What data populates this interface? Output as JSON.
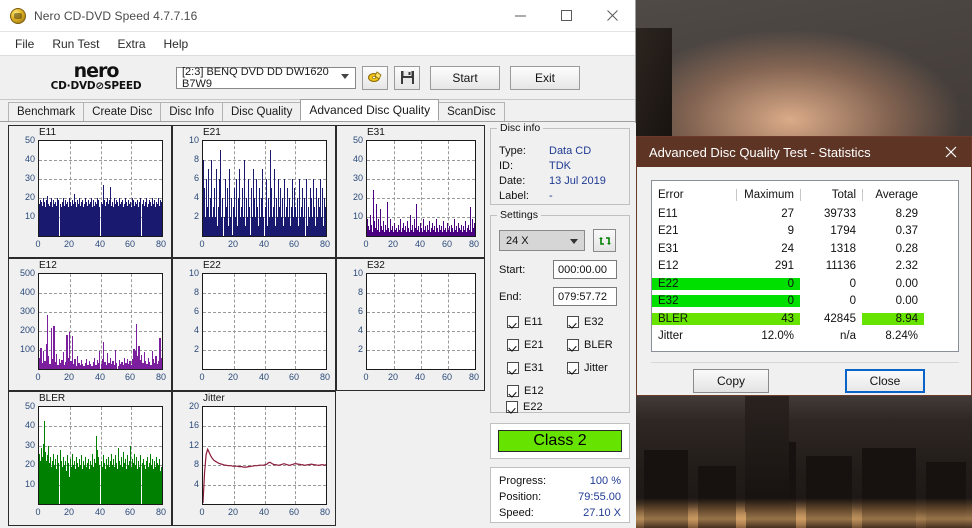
{
  "window": {
    "title": "Nero CD-DVD Speed 4.7.7.16",
    "icon": "nero-disc-icon",
    "minimize": "minimize-icon",
    "maximize": "maximize-icon",
    "close": "close-icon"
  },
  "menubar": {
    "items": [
      "File",
      "Run Test",
      "Extra",
      "Help"
    ]
  },
  "brand": {
    "line1": "nero",
    "line2": "CD·DVD⊘SPEED"
  },
  "toolbar": {
    "drive": "[2:3]   BENQ DVD DD DW1620 B7W9",
    "eject_icon": "eject-disc-icon",
    "save_icon": "floppy-save-icon",
    "start_label": "Start",
    "exit_label": "Exit"
  },
  "tabs": [
    {
      "label": "Benchmark",
      "active": false
    },
    {
      "label": "Create Disc",
      "active": false
    },
    {
      "label": "Disc Info",
      "active": false
    },
    {
      "label": "Disc Quality",
      "active": false
    },
    {
      "label": "Advanced Disc Quality",
      "active": true
    },
    {
      "label": "ScanDisc",
      "active": false
    }
  ],
  "disc_info": {
    "legend": "Disc info",
    "rows": [
      {
        "key": "Type:",
        "value": "Data CD"
      },
      {
        "key": "ID:",
        "value": "TDK"
      },
      {
        "key": "Date:",
        "value": "13 Jul 2019"
      },
      {
        "key": "Label:",
        "value": "-"
      }
    ]
  },
  "settings": {
    "legend": "Settings",
    "speed": "24 X",
    "refresh_icon": "refresh-speed-icon",
    "start_label": "Start:",
    "start_value": "000:00.00",
    "end_label": "End:",
    "end_value": "079:57.72",
    "checkboxes_left": [
      "E11",
      "E21",
      "E31",
      "E12",
      "E22"
    ],
    "checkboxes_right": [
      "E32",
      "BLER",
      "Jitter"
    ]
  },
  "class_badge": {
    "label": "Class 2",
    "color": "#66e400"
  },
  "progress": {
    "rows": [
      {
        "key": "Progress:",
        "value": "100 %"
      },
      {
        "key": "Position:",
        "value": "79:55.00"
      },
      {
        "key": "Speed:",
        "value": "27.10 X"
      }
    ]
  },
  "statistics": {
    "title": "Advanced Disc Quality Test - Statistics",
    "close_icon": "close-icon",
    "columns": [
      "Error",
      "Maximum",
      "Total",
      "Average"
    ],
    "rows": [
      {
        "error": "E11",
        "maximum": "27",
        "total": "39733",
        "average": "8.29",
        "highlight": "none"
      },
      {
        "error": "E21",
        "maximum": "9",
        "total": "1794",
        "average": "0.37",
        "highlight": "none"
      },
      {
        "error": "E31",
        "maximum": "24",
        "total": "1318",
        "average": "0.28",
        "highlight": "none"
      },
      {
        "error": "E12",
        "maximum": "291",
        "total": "11136",
        "average": "2.32",
        "highlight": "none"
      },
      {
        "error": "E22",
        "maximum": "0",
        "total": "0",
        "average": "0.00",
        "highlight": "green-left"
      },
      {
        "error": "E32",
        "maximum": "0",
        "total": "0",
        "average": "0.00",
        "highlight": "green-left"
      },
      {
        "error": "BLER",
        "maximum": "43",
        "total": "42845",
        "average": "8.94",
        "highlight": "lime-left-avg"
      },
      {
        "error": "Jitter",
        "maximum": "12.0%",
        "total": "n/a",
        "average": "8.24%",
        "highlight": "none"
      }
    ],
    "copy_label": "Copy",
    "close_label": "Close",
    "colors": {
      "title_bar": "#5e3524",
      "green": "#00e000",
      "lime": "#66e400"
    }
  },
  "chart_data": [
    {
      "type": "bar",
      "name": "E11",
      "title": "E11",
      "color": "#191970",
      "xlabel": "",
      "ylabel": "",
      "xlim": [
        0,
        80
      ],
      "ylim": [
        0,
        50
      ],
      "grid": true,
      "xticks": [
        0,
        20,
        40,
        60,
        80
      ],
      "yticks": [
        10,
        20,
        30,
        40,
        50
      ],
      "values": [
        17,
        19,
        18,
        16,
        20,
        18,
        15,
        19,
        21,
        17,
        16,
        18,
        20,
        15,
        19,
        17,
        18,
        16,
        20,
        19,
        17,
        15,
        18,
        20,
        16,
        19,
        17,
        18,
        15,
        20,
        18,
        16,
        19,
        17,
        22,
        18,
        15,
        19,
        17,
        20,
        16,
        18,
        19,
        15,
        17,
        20,
        18,
        16,
        19,
        17,
        18,
        20,
        15,
        19,
        16,
        18,
        17,
        20,
        19,
        15,
        18,
        17,
        27,
        19,
        16,
        18,
        20,
        17,
        19,
        26,
        16,
        18,
        15,
        20,
        17,
        19,
        18,
        16,
        20,
        17,
        18,
        19,
        15,
        17,
        20,
        18,
        16,
        19,
        17,
        18,
        15,
        20,
        19,
        16,
        18,
        17,
        19,
        15,
        18,
        20,
        17,
        19,
        16,
        18,
        20,
        15,
        17,
        19,
        18,
        16,
        20,
        17,
        19,
        15,
        18,
        17,
        20,
        16,
        19,
        18
      ]
    },
    {
      "type": "bar",
      "name": "E21",
      "title": "E21",
      "color": "#191970",
      "xlabel": "",
      "ylabel": "",
      "xlim": [
        0,
        80
      ],
      "ylim": [
        0,
        10
      ],
      "grid": true,
      "xticks": [
        0,
        20,
        40,
        60,
        80
      ],
      "yticks": [
        2,
        4,
        6,
        8,
        10
      ],
      "values": [
        8,
        5,
        2,
        6,
        3,
        7,
        2,
        4,
        8,
        2,
        3,
        5,
        2,
        7,
        1,
        3,
        6,
        9,
        2,
        4,
        2,
        6,
        3,
        5,
        1,
        7,
        2,
        4,
        0,
        3,
        5,
        2,
        6,
        1,
        4,
        7,
        2,
        3,
        5,
        2,
        8,
        1,
        4,
        2,
        6,
        3,
        0,
        5,
        2,
        7,
        4,
        2,
        6,
        3,
        1,
        5,
        2,
        4,
        7,
        2,
        3,
        6,
        1,
        4,
        2,
        9,
        5,
        2,
        3,
        7,
        1,
        4,
        2,
        6,
        3,
        5,
        2,
        4,
        1,
        6,
        2,
        3,
        5,
        2,
        4,
        1,
        3,
        6,
        2,
        5,
        3,
        2,
        4,
        1,
        6,
        2,
        3,
        5,
        2,
        4,
        6,
        1,
        3,
        2,
        5,
        4,
        2,
        6,
        3,
        1,
        5,
        2,
        4,
        3,
        6,
        2,
        5,
        1,
        4,
        3
      ]
    },
    {
      "type": "bar",
      "name": "E31",
      "title": "E31",
      "color": "#4b0082",
      "xlabel": "",
      "ylabel": "",
      "xlim": [
        0,
        80
      ],
      "ylim": [
        0,
        50
      ],
      "grid": true,
      "xticks": [
        0,
        20,
        40,
        60,
        80
      ],
      "yticks": [
        10,
        20,
        30,
        40,
        50
      ],
      "values": [
        9,
        5,
        3,
        11,
        6,
        2,
        24,
        8,
        4,
        17,
        3,
        9,
        2,
        14,
        5,
        3,
        8,
        2,
        6,
        3,
        18,
        4,
        2,
        9,
        3,
        5,
        2,
        7,
        3,
        4,
        2,
        6,
        3,
        9,
        2,
        4,
        7,
        3,
        5,
        2,
        8,
        4,
        2,
        11,
        3,
        6,
        2,
        9,
        4,
        17,
        3,
        5,
        2,
        7,
        4,
        2,
        9,
        3,
        5,
        2,
        6,
        3,
        8,
        2,
        4,
        7,
        3,
        5,
        2,
        9,
        4,
        2,
        6,
        3,
        5,
        2,
        8,
        3,
        4,
        2,
        7,
        3,
        5,
        2,
        6,
        4,
        2,
        9,
        3,
        5,
        2,
        7,
        4,
        3,
        6,
        2,
        5,
        3,
        8,
        2,
        4,
        6,
        3,
        15,
        2,
        9,
        4,
        7,
        3,
        5,
        2,
        11,
        4,
        6,
        2,
        8,
        3,
        5,
        9,
        7
      ]
    },
    {
      "type": "bar",
      "name": "E12",
      "title": "E12",
      "color": "#7b1f9e",
      "xlabel": "",
      "ylabel": "",
      "xlim": [
        0,
        80
      ],
      "ylim": [
        0,
        500
      ],
      "grid": true,
      "xticks": [
        0,
        20,
        40,
        60,
        80
      ],
      "yticks": [
        100,
        200,
        300,
        400,
        500
      ],
      "values": [
        60,
        110,
        30,
        95,
        40,
        130,
        285,
        70,
        25,
        215,
        50,
        225,
        35,
        80,
        20,
        55,
        30,
        45,
        90,
        20,
        35,
        180,
        60,
        195,
        40,
        175,
        25,
        55,
        15,
        70,
        30,
        20,
        45,
        25,
        15,
        30,
        55,
        20,
        40,
        25,
        15,
        35,
        60,
        20,
        45,
        30,
        95,
        25,
        50,
        140,
        35,
        20,
        85,
        30,
        60,
        25,
        40,
        20,
        100,
        30,
        15,
        45,
        25,
        35,
        20,
        60,
        30,
        50,
        25,
        40,
        20,
        55,
        105,
        95,
        235,
        70,
        120,
        45,
        75,
        30,
        90,
        40,
        25,
        60,
        35,
        20,
        95,
        50,
        30,
        70,
        25,
        40,
        165,
        60
      ]
    },
    {
      "type": "bar",
      "name": "E22",
      "title": "E22",
      "color": "#191970",
      "xlabel": "",
      "ylabel": "",
      "xlim": [
        0,
        80
      ],
      "ylim": [
        0,
        10
      ],
      "grid": true,
      "xticks": [
        0,
        20,
        40,
        60,
        80
      ],
      "yticks": [
        2,
        4,
        6,
        8,
        10
      ],
      "values": []
    },
    {
      "type": "bar",
      "name": "E32",
      "title": "E32",
      "color": "#191970",
      "xlabel": "",
      "ylabel": "",
      "xlim": [
        0,
        80
      ],
      "ylim": [
        0,
        10
      ],
      "grid": true,
      "xticks": [
        0,
        20,
        40,
        60,
        80
      ],
      "yticks": [
        2,
        4,
        6,
        8,
        10
      ],
      "values": []
    },
    {
      "type": "bar",
      "name": "BLER",
      "title": "BLER",
      "color": "#008000",
      "xlabel": "",
      "ylabel": "",
      "xlim": [
        0,
        80
      ],
      "ylim": [
        0,
        50
      ],
      "grid": true,
      "xticks": [
        0,
        20,
        40,
        60,
        80
      ],
      "yticks": [
        10,
        20,
        30,
        40,
        50
      ],
      "values": [
        26,
        22,
        29,
        24,
        31,
        43,
        27,
        22,
        25,
        30,
        21,
        24,
        19,
        22,
        26,
        20,
        23,
        18,
        25,
        21,
        28,
        22,
        19,
        24,
        20,
        22,
        17,
        25,
        21,
        14,
        23,
        19,
        26,
        20,
        22,
        18,
        24,
        21,
        19,
        23,
        20,
        25,
        18,
        22,
        20,
        24,
        19,
        21,
        23,
        18,
        22,
        20,
        26,
        19,
        23,
        21,
        35,
        28,
        24,
        20,
        22,
        19,
        25,
        21,
        18,
        23,
        20,
        24,
        19,
        22,
        26,
        20,
        23,
        19,
        25,
        21,
        18,
        29,
        22,
        20,
        24,
        19,
        27,
        21,
        23,
        18,
        25,
        20,
        22,
        30,
        19,
        23,
        21,
        26,
        20,
        24,
        18,
        22,
        19,
        25,
        21,
        23,
        20,
        18,
        22,
        24,
        19,
        21,
        26,
        20,
        23,
        18,
        22,
        19,
        24,
        21,
        20,
        23,
        17,
        19
      ]
    },
    {
      "type": "line",
      "name": "Jitter",
      "title": "Jitter",
      "color": "#8b1a3a",
      "xlabel": "",
      "ylabel": "",
      "xlim": [
        0,
        80
      ],
      "ylim": [
        0,
        20
      ],
      "grid": true,
      "xticks": [
        0,
        20,
        40,
        60,
        80
      ],
      "yticks": [
        4,
        8,
        12,
        16,
        20
      ],
      "values": [
        0.2,
        6.5,
        10.2,
        11.3,
        10.6,
        9.9,
        9.4,
        9.0,
        8.8,
        8.6,
        8.4,
        8.3,
        8.2,
        8.1,
        8.0,
        8.0,
        7.9,
        7.9,
        7.9,
        7.8,
        7.8,
        7.8,
        7.8,
        7.7,
        7.7,
        7.7,
        7.6,
        7.6,
        7.6,
        7.7,
        7.7,
        7.8,
        7.8,
        7.9,
        7.9,
        7.9,
        8.0,
        8.0,
        8.0,
        8.0,
        8.1,
        8.2,
        8.5,
        8.6,
        8.4,
        8.2,
        8.1,
        8.1,
        8.0,
        8.0,
        8.1,
        8.2,
        8.3,
        8.2,
        8.1,
        8.0,
        8.0,
        8.1,
        8.2,
        8.3,
        8.3,
        8.2,
        8.2,
        8.1,
        8.1,
        8.0,
        8.0,
        8.1,
        8.1,
        8.2,
        8.2,
        8.1,
        8.1,
        8.0,
        8.0,
        8.0,
        8.1,
        8.1,
        8.0,
        8.1
      ]
    }
  ]
}
